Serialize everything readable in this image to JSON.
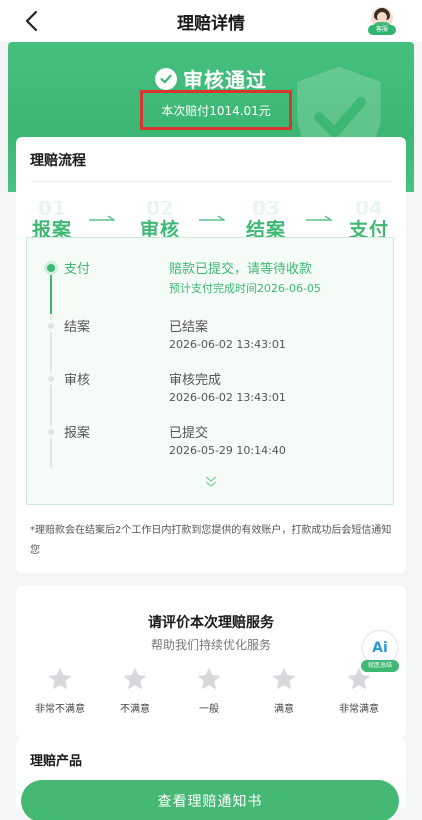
{
  "nav": {
    "title": "理赔详情",
    "avatar_badge": "客服"
  },
  "hero": {
    "status": "审核通过",
    "amount_text": "本次赔付1014.01元"
  },
  "flow": {
    "title": "理赔流程",
    "steps": [
      {
        "num": "01",
        "label": "报案"
      },
      {
        "num": "02",
        "label": "审核"
      },
      {
        "num": "03",
        "label": "结案"
      },
      {
        "num": "04",
        "label": "支付"
      }
    ],
    "timeline": [
      {
        "step": "支付",
        "status": "赔款已提交，请等待收款",
        "time": "预计支付完成时间2026-06-05",
        "active": true
      },
      {
        "step": "结案",
        "status": "已结案",
        "time": "2026-06-02 13:43:01",
        "active": false
      },
      {
        "step": "审核",
        "status": "审核完成",
        "time": "2026-06-02 13:43:01",
        "active": false
      },
      {
        "step": "报案",
        "status": "已提交",
        "time": "2026-05-29 10:14:40",
        "active": false
      }
    ],
    "note": "*理赔款会在结案后2个工作日内打款到您提供的有效账户，打款成功后会短信通知您"
  },
  "rating": {
    "title": "请评价本次理赔服务",
    "subtitle": "帮助我们持续优化服务",
    "options": [
      "非常不满意",
      "不满意",
      "一般",
      "满意",
      "非常满意"
    ]
  },
  "ai": {
    "label": "Ai",
    "badge": "就医总结"
  },
  "product": {
    "title": "理赔产品"
  },
  "bottom": {
    "button_label": "查看理赔通知书"
  },
  "colors": {
    "brand_green": "#3fb874",
    "highlight_red": "#d9352e"
  }
}
